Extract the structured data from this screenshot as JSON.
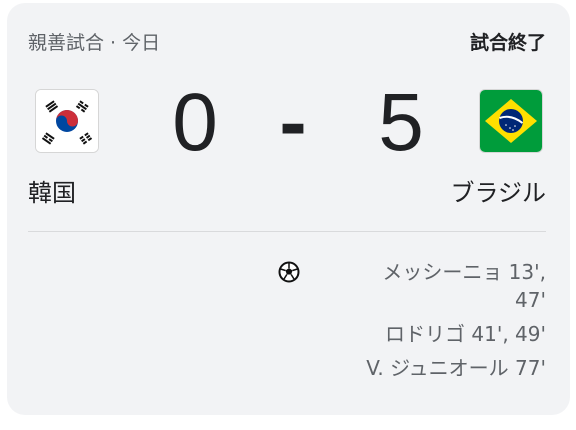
{
  "header": {
    "match_type": "親善試合 · 今日",
    "match_status": "試合終了"
  },
  "home_team": {
    "name": "韓国",
    "score": "0",
    "flag_icon": "south-korea-flag-icon"
  },
  "away_team": {
    "name": "ブラジル",
    "score": "5",
    "flag_icon": "brazil-flag-icon"
  },
  "score_separator": "-",
  "goals": {
    "icon": "soccer-ball-icon",
    "away_scorers": [
      {
        "player": "メッシーニョ 13',",
        "minutes_cont": "47'"
      },
      {
        "player": "ロドリゴ 41', 49'"
      },
      {
        "player": "V. ジュニオール 77'"
      }
    ]
  },
  "colors": {
    "card_background": "#f2f3f5",
    "text_primary": "#202124",
    "text_secondary": "#5f6368",
    "brazil_green": "#009c3b",
    "brazil_yellow": "#ffdf00",
    "brazil_blue": "#002776",
    "korea_red": "#cd2e3a",
    "korea_blue": "#0047a0"
  }
}
